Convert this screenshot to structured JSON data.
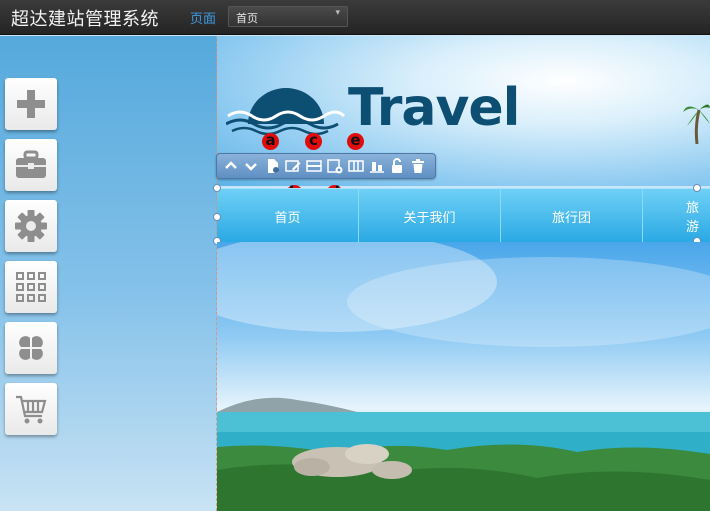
{
  "topbar": {
    "app_title": "超达建站管理系统",
    "page_label": "页面",
    "page_select_value": "首页"
  },
  "left_tools": [
    {
      "icon": "plus-icon"
    },
    {
      "icon": "toolbox-icon"
    },
    {
      "icon": "gear-icon"
    },
    {
      "icon": "grid-icon"
    },
    {
      "icon": "clover-icon"
    },
    {
      "icon": "cart-icon"
    }
  ],
  "site": {
    "logo_text": "Travel"
  },
  "element_toolbar": {
    "markers": [
      "a",
      "b",
      "c",
      "d",
      "e"
    ]
  },
  "nav": {
    "items": [
      "首页",
      "关于我们",
      "旅行团",
      "旅游"
    ]
  },
  "colors": {
    "topbar": "#2e2e2e",
    "accent": "#3d9be0",
    "nav": "#2aa9e4",
    "toolbar": "#6f9ccd",
    "marker": "#e30c0c"
  }
}
